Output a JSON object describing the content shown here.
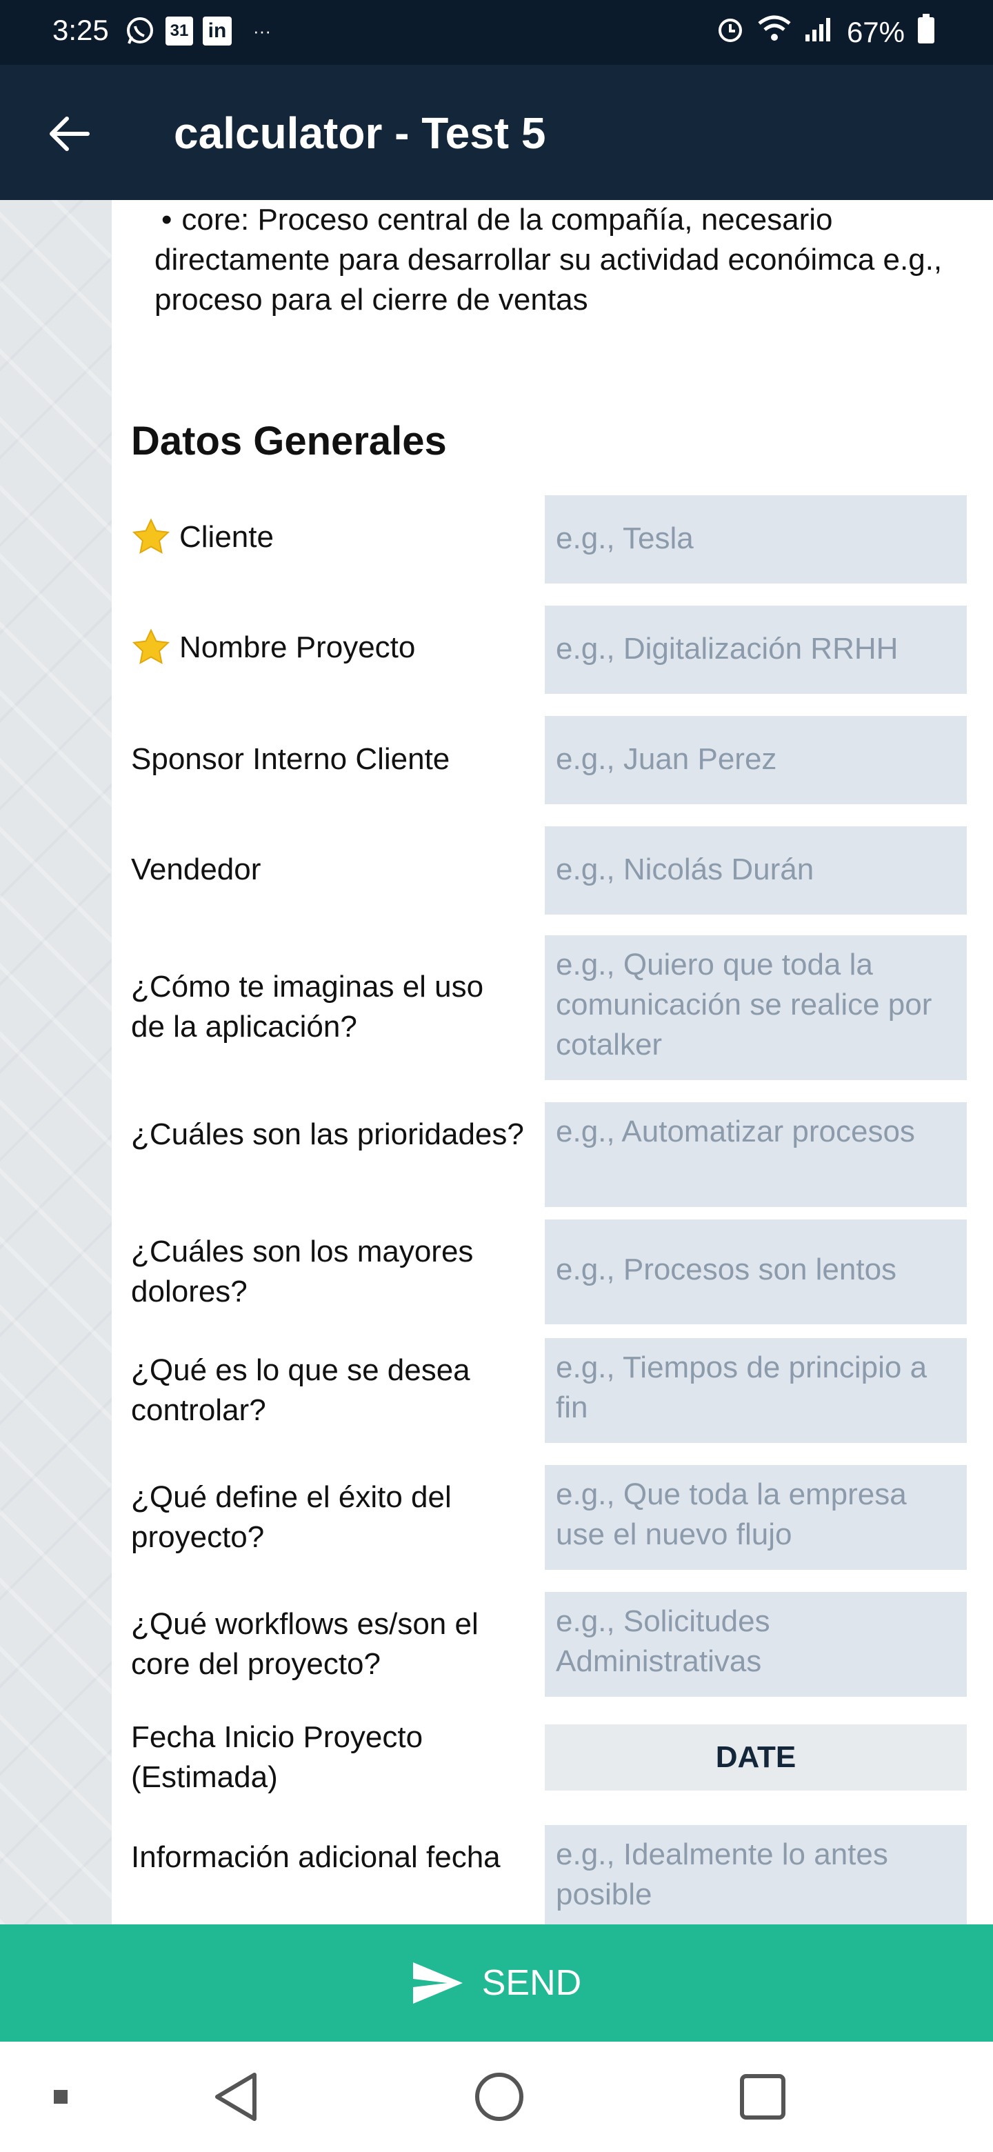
{
  "status": {
    "time": "3:25",
    "calendar_day": "31",
    "battery": "67%",
    "more": "···"
  },
  "appbar": {
    "title": "calculator - Test 5"
  },
  "intro": {
    "bullet": "•",
    "text": "core: Proceso central de la compañía, necesario directamente para desarrollar su actividad econóimca e.g., proceso para el cierre de ventas"
  },
  "section": {
    "title": "Datos Generales"
  },
  "fields": [
    {
      "label": "Cliente",
      "placeholder": "e.g., Tesla",
      "required": true
    },
    {
      "label": "Nombre Proyecto",
      "placeholder": "e.g., Digitalización RRHH",
      "required": true
    },
    {
      "label": "Sponsor Interno Cliente",
      "placeholder": "e.g., Juan Perez",
      "required": false
    },
    {
      "label": "Vendedor",
      "placeholder": "e.g., Nicolás Durán",
      "required": false
    },
    {
      "label": "¿Cómo te imaginas el uso de la aplicación?",
      "placeholder": "e.g., Quiero que toda la comunicación se realice por cotalker",
      "required": false
    },
    {
      "label": "¿Cuáles son las prioridades?",
      "placeholder": "e.g., Automatizar procesos",
      "required": false
    },
    {
      "label": "¿Cuáles son los mayores dolores?",
      "placeholder": "e.g., Procesos son lentos",
      "required": false
    },
    {
      "label": "¿Qué es lo que se desea controlar?",
      "placeholder": "e.g., Tiempos de principio a fin",
      "required": false
    },
    {
      "label": "¿Qué define el éxito del proyecto?",
      "placeholder": "e.g., Que toda la empresa use el nuevo flujo",
      "required": false
    },
    {
      "label": "¿Qué workflows es/son el core del proyecto?",
      "placeholder": "e.g., Solicitudes Administrativas",
      "required": false
    }
  ],
  "date_field": {
    "label": "Fecha Inicio Proyecto (Estimada)",
    "button": "DATE"
  },
  "extra_field": {
    "label": "Información adicional fecha",
    "placeholder": "e.g., Idealmente lo antes posible"
  },
  "send": {
    "label": "SEND"
  },
  "colors": {
    "appbar": "#13263a",
    "send": "#21b894",
    "field_bg": "#dfe5ec"
  }
}
